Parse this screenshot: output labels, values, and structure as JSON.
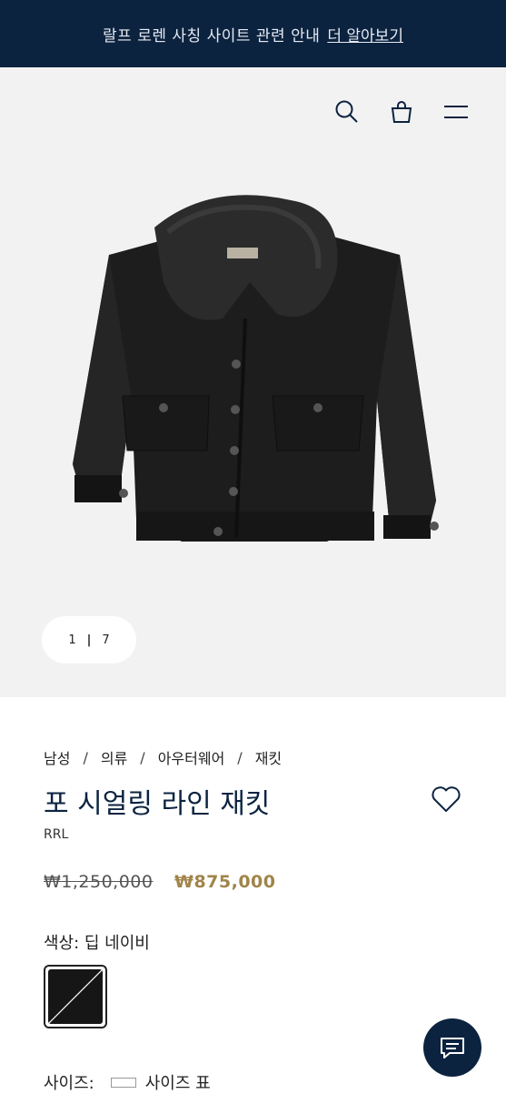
{
  "banner": {
    "text": "랄프 로렌 사칭 사이트 관련 안내",
    "link": "더 알아보기"
  },
  "header": {
    "icons": [
      "search-icon",
      "bag-icon",
      "menu-icon"
    ]
  },
  "gallery": {
    "current": "1",
    "total": "7"
  },
  "breadcrumb": [
    "남성",
    "의류",
    "아우터웨어",
    "재킷"
  ],
  "product": {
    "title": "포 시얼링 라인 재킷",
    "brand": "RRL",
    "price_original": "₩1,250,000",
    "price_sale": "₩875,000",
    "color_label": "색상: 딥 네이비",
    "size_label": "사이즈:",
    "size_guide": "사이즈 표"
  },
  "colors": {
    "banner_bg": "#0c2340",
    "sale_price": "#a08449",
    "title": "#0c2340"
  }
}
